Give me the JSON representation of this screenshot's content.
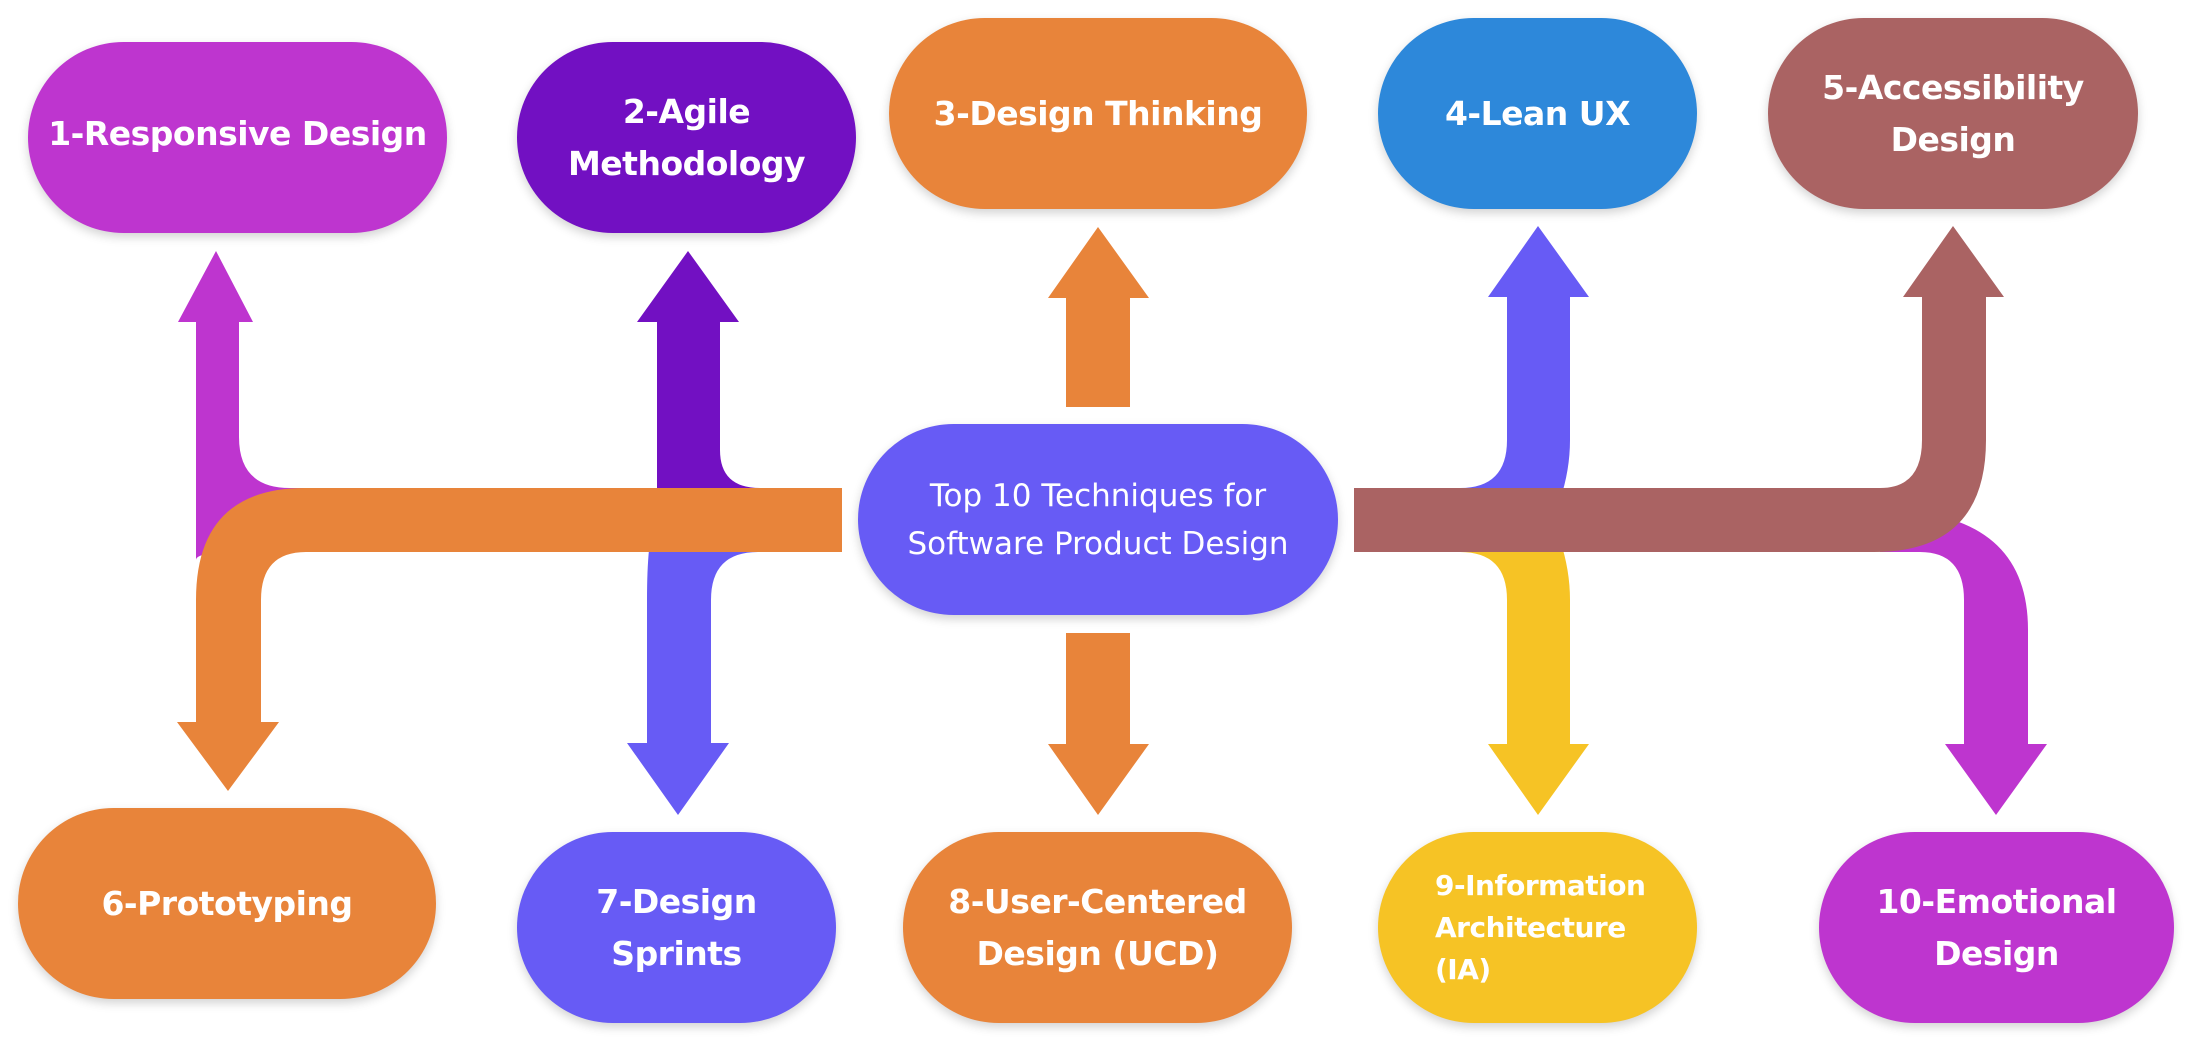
{
  "title": "Top 10 Techniques for Software Product Design",
  "colors": {
    "magenta": "#BE35CF",
    "deep_purple": "#7210C2",
    "orange": "#E8843A",
    "blue": "#2D88DA",
    "brown": "#AA6363",
    "indigo": "#675BF5",
    "yellow": "#F6C325",
    "text": "#FFFFFF",
    "background": "#FFFFFF"
  },
  "center": {
    "label": "Top 10 Techniques for\nSoftware Product Design",
    "color": "#675BF5"
  },
  "techniques": [
    {
      "number": 1,
      "label": "1-Responsive Design",
      "color": "#BE35CF",
      "row": "top"
    },
    {
      "number": 2,
      "label": "2-Agile\nMethodology",
      "color": "#7210C2",
      "row": "top"
    },
    {
      "number": 3,
      "label": "3-Design Thinking",
      "color": "#E8843A",
      "row": "top"
    },
    {
      "number": 4,
      "label": "4-Lean UX",
      "color": "#2D88DA",
      "row": "top"
    },
    {
      "number": 5,
      "label": "5-Accessibility\nDesign",
      "color": "#AA6363",
      "row": "top"
    },
    {
      "number": 6,
      "label": "6-Prototyping",
      "color": "#E8843A",
      "row": "bottom"
    },
    {
      "number": 7,
      "label": "7-Design\nSprints",
      "color": "#675BF5",
      "row": "bottom"
    },
    {
      "number": 8,
      "label": "8-User-Centered\nDesign (UCD)",
      "color": "#E8843A",
      "row": "bottom"
    },
    {
      "number": 9,
      "label": "9-Information\nArchitecture (IA)",
      "color": "#F6C325",
      "row": "bottom"
    },
    {
      "number": 10,
      "label": "10-Emotional\nDesign",
      "color": "#BE35CF",
      "row": "bottom"
    }
  ],
  "connectors": [
    {
      "to": 1,
      "color": "#BE35CF",
      "direction": "up"
    },
    {
      "to": 2,
      "color": "#7210C2",
      "direction": "up"
    },
    {
      "to": 3,
      "color": "#E8843A",
      "direction": "up"
    },
    {
      "to": 4,
      "color": "#675BF5",
      "direction": "up"
    },
    {
      "to": 5,
      "color": "#AA6363",
      "direction": "up"
    },
    {
      "to": 6,
      "color": "#E8843A",
      "direction": "down"
    },
    {
      "to": 7,
      "color": "#675BF5",
      "direction": "down"
    },
    {
      "to": 8,
      "color": "#E8843A",
      "direction": "down"
    },
    {
      "to": 9,
      "color": "#F6C325",
      "direction": "down"
    },
    {
      "to": 10,
      "color": "#BE35CF",
      "direction": "down"
    }
  ]
}
